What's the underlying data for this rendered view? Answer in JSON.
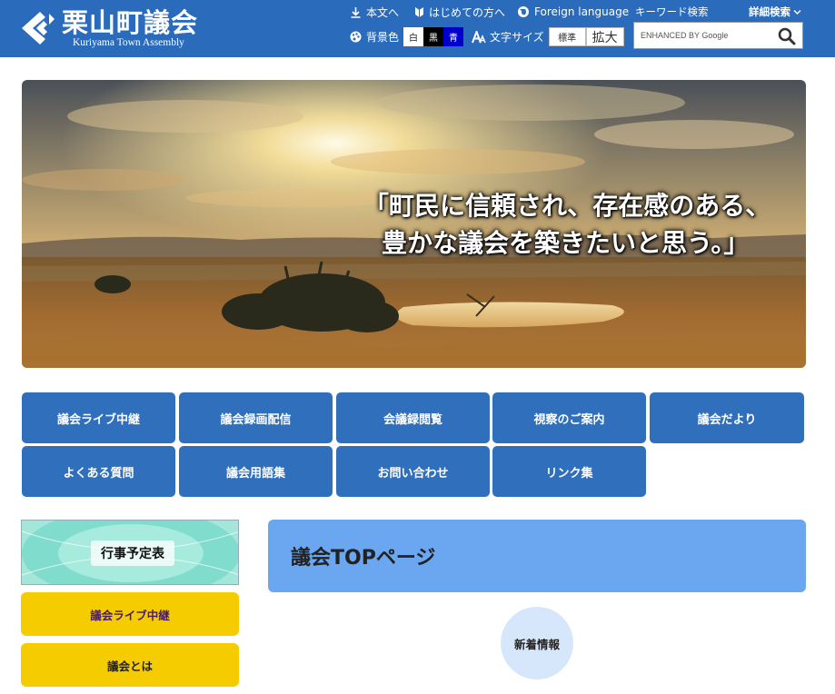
{
  "header": {
    "logo_title": "栗山町議会",
    "logo_subtitle": "Kuriyama Town Assembly",
    "main_text_link": "本文へ",
    "first_time_link": "はじめての方へ",
    "foreign_language_link": "Foreign language",
    "background_color_label": "背景色",
    "bg_white": "白",
    "bg_black": "黒",
    "bg_blue": "青",
    "font_size_label": "文字サイズ",
    "font_standard": "標準",
    "font_large": "拡大",
    "keyword_search_label": "キーワード検索",
    "advanced_search_label": "詳細検索",
    "search_placeholder": "ENHANCED BY Google"
  },
  "hero": {
    "catch_line1": "「町民に信頼され、存在感のある、",
    "catch_line2": "豊かな議会を築きたいと思う。」"
  },
  "nav": {
    "items": [
      "議会ライブ中継",
      "議会録画配信",
      "会議録閲覧",
      "視察のご案内",
      "議会だより",
      "よくある質問",
      "議会用語集",
      "お問い合わせ",
      "リンク集"
    ]
  },
  "sidebar": {
    "calendar_label": "行事予定表",
    "live_button": "議会ライブ中継",
    "about_button": "議会とは"
  },
  "main": {
    "page_title": "議会TOPページ",
    "news_label": "新着情報"
  },
  "colors": {
    "header_bg": "#2a6bbb",
    "nav_button": "#2f6fbb",
    "sidebar_button": "#f5cc00",
    "title_box": "#6ba6f0",
    "news_circle": "#d6e7fb"
  },
  "icons": {
    "logo": "kuriyama-emblem-icon",
    "main_text": "download-arrow-icon",
    "first_time": "beginner-mark-icon",
    "foreign": "globe-icon",
    "background": "palette-icon",
    "font_size": "font-size-icon",
    "search": "search-icon",
    "advanced": "chevron-down-icon"
  }
}
